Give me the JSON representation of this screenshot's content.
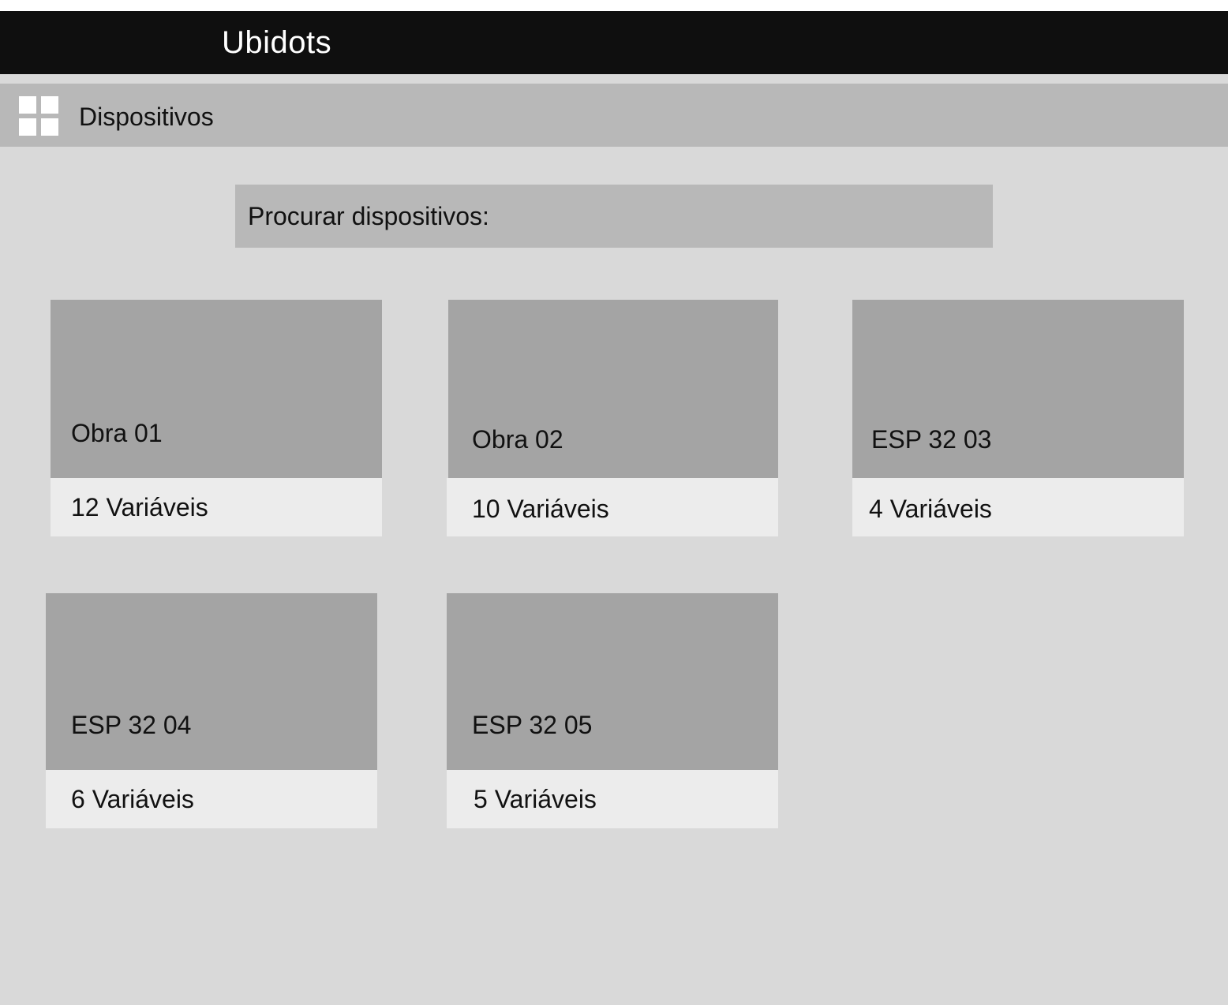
{
  "app": {
    "title": "Ubidots"
  },
  "header": {
    "icon": "grid-icon",
    "title": "Dispositivos"
  },
  "search": {
    "placeholder": "Procurar dispositivos:",
    "value": ""
  },
  "devices": [
    {
      "name": "Obra 01",
      "variables": "12 Variáveis"
    },
    {
      "name": "Obra 02",
      "variables": "10 Variáveis"
    },
    {
      "name": "ESP 32 03",
      "variables": "4 Variáveis"
    },
    {
      "name": "ESP 32 04",
      "variables": "6 Variáveis"
    },
    {
      "name": "ESP 32 05",
      "variables": "5 Variáveis"
    }
  ],
  "colors": {
    "topbar": "#0f0f0f",
    "background": "#d9d9d9",
    "header_strip": "#b8b8b8",
    "card_top": "#a4a4a4",
    "card_bottom": "#ececec"
  }
}
